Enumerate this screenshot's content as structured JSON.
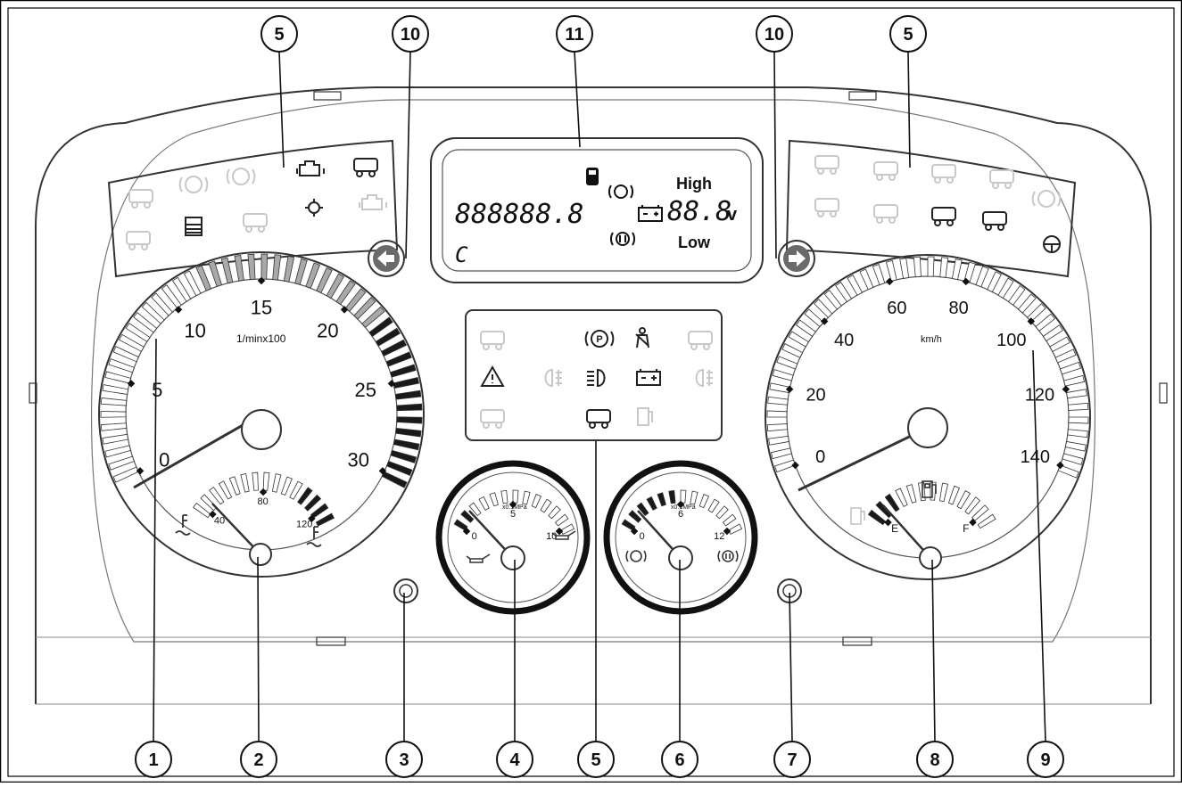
{
  "callouts": {
    "top": [
      "5",
      "10",
      "11",
      "10",
      "5"
    ],
    "bottom": [
      "1",
      "2",
      "3",
      "4",
      "5",
      "6",
      "7",
      "8",
      "9"
    ]
  },
  "tachometer": {
    "ticks": [
      "0",
      "5",
      "10",
      "15",
      "20",
      "25",
      "30"
    ],
    "unit": "1/minx100",
    "value_rpm_x100": 0
  },
  "coolant_gauge": {
    "ticks": [
      "40",
      "80",
      "120"
    ],
    "icons": [
      "coolant-temp-icon",
      "coolant-hot-icon"
    ]
  },
  "oil_pressure_gauge": {
    "ticks": [
      "0",
      "5",
      "10"
    ],
    "unit": "x0.1MPa",
    "icons": [
      "oil-can-icon",
      "oil-can-icon"
    ]
  },
  "air_pressure_gauge": {
    "ticks": [
      "0",
      "6",
      "12"
    ],
    "unit": "x0.1MPa",
    "icons": [
      "brake-circuit-1-icon",
      "brake-circuit-2-icon"
    ]
  },
  "speedometer": {
    "ticks": [
      "0",
      "20",
      "40",
      "60",
      "80",
      "100",
      "120",
      "140"
    ],
    "unit": "km/h",
    "value_kmh": 0
  },
  "fuel_gauge": {
    "ticks": [
      "E",
      "F"
    ],
    "icons": [
      "fuel-pump-icon",
      "fuel-pump-icon"
    ]
  },
  "display": {
    "odometer": "888888.8",
    "mode": "C",
    "voltage": "88.8",
    "voltage_unit": "v",
    "high_label": "High",
    "low_label": "Low",
    "icons": [
      "fuel-filter-icon",
      "brake-circuit-1-icon",
      "battery-icon",
      "brake-circuit-2-icon"
    ]
  },
  "indicator_groups": {
    "left": [
      "diff-lock-icon",
      "abs-trailer-icon",
      "abs-icon",
      "engine-check-icon",
      "trailer-warning-icon",
      "axle-lock-icon",
      "coolant-level-icon",
      "engine-oil-icon",
      "gear-icon",
      "engine-warning-icon"
    ],
    "center": [
      "trailer-left-icon",
      "parking-brake-icon",
      "seatbelt-icon",
      "trailer-right-icon",
      "hazard-icon",
      "front-fog-icon",
      "high-beam-icon",
      "battery-icon",
      "rear-fog-icon",
      "retarder-icon",
      "truck-trailer-icon",
      "fuel-low-icon"
    ],
    "right": [
      "pto-icon",
      "suspension-icon",
      "glow-plug-icon",
      "cab-tilt-icon",
      "abs-trailer-icon",
      "lift-axle-icon",
      "def-icon",
      "cab-lock-icon",
      "door-open-icon",
      "steering-icon"
    ]
  },
  "colors": {
    "line": "#2a2a2a",
    "panel": "#ffffff",
    "faded_icon": "#c8c8c8",
    "active_icon": "#222222",
    "tick_grey": "#a9a9a9",
    "tick_dark": "#1a1a1a"
  }
}
